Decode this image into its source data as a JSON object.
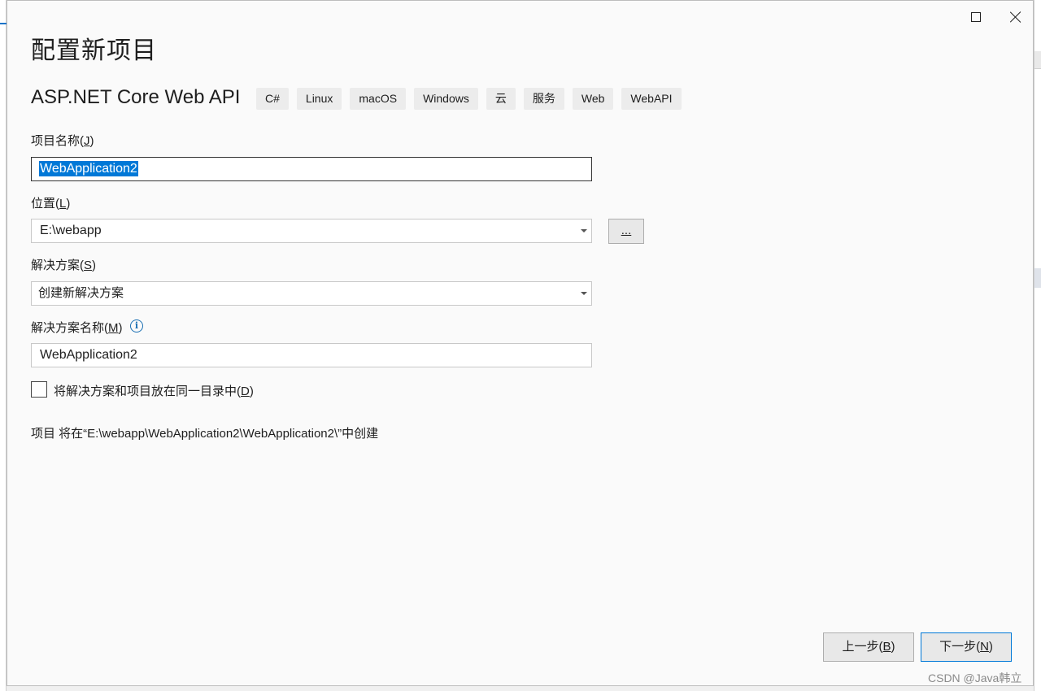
{
  "dialog": {
    "title": "配置新项目",
    "template_name": "ASP.NET Core Web API",
    "tags": [
      "C#",
      "Linux",
      "macOS",
      "Windows",
      "云",
      "服务",
      "Web",
      "WebAPI"
    ]
  },
  "project_name": {
    "label": "项目名称",
    "accesskey": "J",
    "value": "WebApplication2"
  },
  "location": {
    "label": "位置",
    "accesskey": "L",
    "value": "E:\\webapp",
    "browse_label": "..."
  },
  "solution": {
    "label": "解决方案",
    "accesskey": "S",
    "value": "创建新解决方案"
  },
  "solution_name": {
    "label": "解决方案名称",
    "accesskey": "M",
    "value": "WebApplication2"
  },
  "same_dir": {
    "label": "将解决方案和项目放在同一目录中",
    "accesskey": "D",
    "checked": false
  },
  "path_note": "项目 将在“E:\\webapp\\WebApplication2\\WebApplication2\\”中创建",
  "footer": {
    "back_label": "上一步",
    "back_key": "B",
    "next_label": "下一步",
    "next_key": "N"
  },
  "watermark": "CSDN @Java韩立",
  "icons": {
    "maximize": "maximize-icon",
    "close": "close-icon",
    "info": "info-icon",
    "dropdown": "chevron-down-icon"
  },
  "colors": {
    "selection": "#0078d7",
    "info": "#1a6fb3",
    "dialog_bg": "#fafafa"
  }
}
